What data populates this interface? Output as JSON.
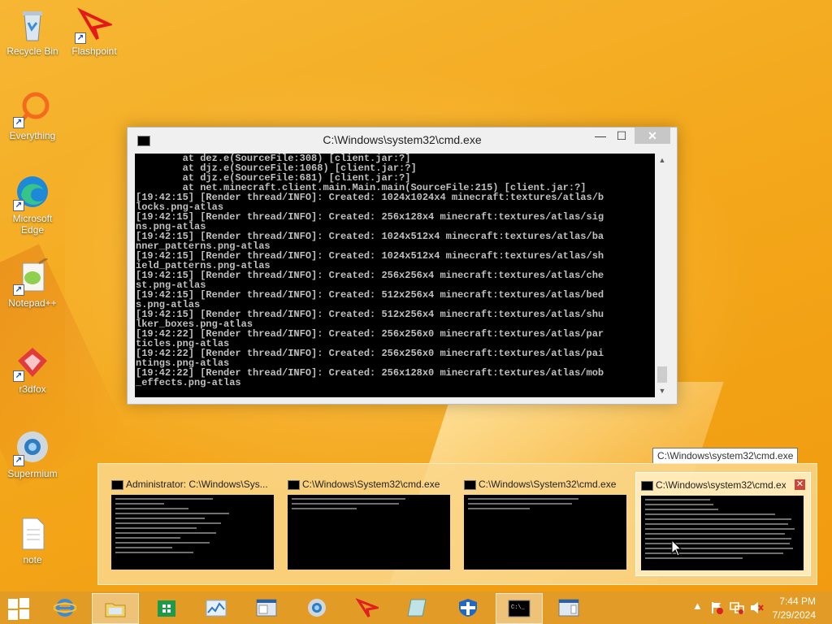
{
  "desktop": {
    "icons": [
      {
        "label": "Recycle Bin",
        "icon": "recycle-bin-icon"
      },
      {
        "label": "Flashpoint",
        "icon": "flashpoint-icon"
      },
      {
        "label": "Everything",
        "icon": "everything-search-icon"
      },
      {
        "label": "Microsoft Edge",
        "icon": "edge-icon"
      },
      {
        "label": "Notepad++",
        "icon": "notepad-plus-plus-icon"
      },
      {
        "label": "r3dfox",
        "icon": "r3dfox-icon"
      },
      {
        "label": "Supermium",
        "icon": "supermium-icon"
      },
      {
        "label": "note",
        "icon": "text-file-icon"
      }
    ]
  },
  "cmd_window": {
    "title": "C:\\Windows\\system32\\cmd.exe",
    "controls": {
      "minimize": "—",
      "maximize": "☐",
      "close": "✕"
    },
    "lines": [
      "        at dez.e(SourceFile:308) [client.jar:?]",
      "        at djz.e(SourceFile:1068) [client.jar:?]",
      "        at djz.e(SourceFile:681) [client.jar:?]",
      "        at net.minecraft.client.main.Main.main(SourceFile:215) [client.jar:?]",
      "[19:42:15] [Render thread/INFO]: Created: 1024x1024x4 minecraft:textures/atlas/b",
      "locks.png-atlas",
      "[19:42:15] [Render thread/INFO]: Created: 256x128x4 minecraft:textures/atlas/sig",
      "ns.png-atlas",
      "[19:42:15] [Render thread/INFO]: Created: 1024x512x4 minecraft:textures/atlas/ba",
      "nner_patterns.png-atlas",
      "[19:42:15] [Render thread/INFO]: Created: 1024x512x4 minecraft:textures/atlas/sh",
      "ield_patterns.png-atlas",
      "[19:42:15] [Render thread/INFO]: Created: 256x256x4 minecraft:textures/atlas/che",
      "st.png-atlas",
      "[19:42:15] [Render thread/INFO]: Created: 512x256x4 minecraft:textures/atlas/bed",
      "s.png-atlas",
      "[19:42:15] [Render thread/INFO]: Created: 512x256x4 minecraft:textures/atlas/shu",
      "lker_boxes.png-atlas",
      "[19:42:22] [Render thread/INFO]: Created: 256x256x0 minecraft:textures/atlas/par",
      "ticles.png-atlas",
      "[19:42:22] [Render thread/INFO]: Created: 256x256x0 minecraft:textures/atlas/pai",
      "ntings.png-atlas",
      "[19:42:22] [Render thread/INFO]: Created: 256x128x0 minecraft:textures/atlas/mob",
      "_effects.png-atlas"
    ]
  },
  "taskbar_thumbnails": {
    "tooltip": "C:\\Windows\\system32\\cmd.exe",
    "items": [
      {
        "title": "Administrator: C:\\Windows\\Sys..."
      },
      {
        "title": "C:\\Windows\\System32\\cmd.exe"
      },
      {
        "title": "C:\\Windows\\System32\\cmd.exe"
      },
      {
        "title": "C:\\Windows\\system32\\cmd.exe"
      }
    ],
    "close_label": "✕"
  },
  "taskbar": {
    "apps": [
      {
        "name": "internet-explorer",
        "icon": "internet-explorer-icon",
        "color": "#3a8be0"
      },
      {
        "name": "file-explorer",
        "icon": "folder-icon",
        "color": "#f3d36b"
      },
      {
        "name": "store",
        "icon": "store-icon",
        "color": "#1e9a4a"
      },
      {
        "name": "task-manager",
        "icon": "chart-icon",
        "color": "#7fb0e8"
      },
      {
        "name": "window-app",
        "icon": "window-icon",
        "color": "#dfe8f0"
      },
      {
        "name": "supermium",
        "icon": "supermium-icon",
        "color": "#2e7dc2"
      },
      {
        "name": "flashpoint",
        "icon": "flashpoint-icon",
        "color": "#e02020"
      },
      {
        "name": "notes",
        "icon": "notes-icon",
        "color": "#bfe3e6"
      },
      {
        "name": "defender",
        "icon": "shield-icon",
        "color": "#1f68c8"
      },
      {
        "name": "cmd",
        "icon": "cmd-icon",
        "color": "#000000"
      },
      {
        "name": "window-app-2",
        "icon": "window-icon",
        "color": "#dfe8f0"
      }
    ],
    "tray": {
      "show_hidden": "▲",
      "flag_icon": "action-center-icon",
      "network_icon": "network-icon",
      "volume_icon": "volume-muted-icon"
    },
    "clock": {
      "time": "7:44 PM",
      "date": "7/29/2024"
    }
  },
  "colors": {
    "wallpaper": "#f4a81c",
    "taskbar": "#e19b28",
    "console_bg": "#000000",
    "console_text": "#c0c0c0"
  }
}
